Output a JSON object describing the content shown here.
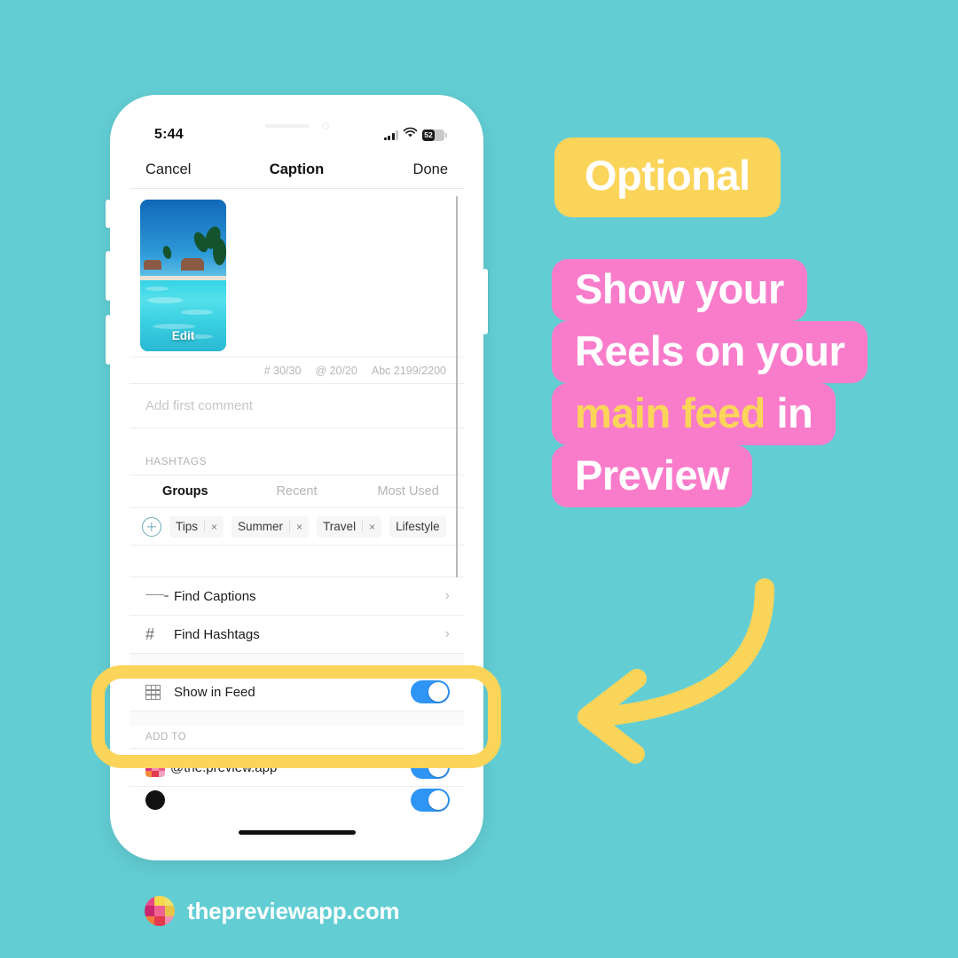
{
  "theme": {
    "background": "#62CED4",
    "yellow": "#FBD45A",
    "pink": "#F97CCB",
    "toggle_blue": "#2F95F5",
    "white": "#FFFFFF"
  },
  "phone": {
    "status_bar": {
      "time": "5:44",
      "signal_icon": "cellular-signal-icon",
      "wifi_icon": "wifi-icon",
      "battery_icon": "battery-icon",
      "battery_percent": "52"
    },
    "nav": {
      "cancel_label": "Cancel",
      "title": "Caption",
      "done_label": "Done"
    },
    "caption": {
      "thumbnail_edit_label": "Edit",
      "counters": [
        "# 30/30",
        "@ 20/20",
        "Abc 2199/2200"
      ],
      "comment_placeholder": "Add first comment"
    },
    "hashtags": {
      "section_label": "HASHTAGS",
      "tabs": [
        {
          "label": "Groups",
          "active": true
        },
        {
          "label": "Recent",
          "active": false
        },
        {
          "label": "Most Used",
          "active": false
        }
      ],
      "add_icon": "plus-circle-icon",
      "chips": [
        {
          "label": "Tips",
          "remove_label": "×"
        },
        {
          "label": "Summer",
          "remove_label": "×"
        },
        {
          "label": "Travel",
          "remove_label": "×"
        },
        {
          "label": "Lifestyle",
          "remove_label": "×"
        }
      ]
    },
    "rows": [
      {
        "label": "Find Captions",
        "icon": "text-lines-icon",
        "accessory": "chevron-right-icon",
        "chevron": "›"
      },
      {
        "label": "Find Hashtags",
        "icon": "hashtag-icon",
        "accessory": "chevron-right-icon",
        "chevron": "›"
      }
    ],
    "show_in_feed": {
      "label": "Show in Feed",
      "icon": "grid-icon",
      "toggle_on": true
    },
    "add_to": {
      "section_label": "ADD TO",
      "accounts": [
        {
          "handle": "@the.preview.app",
          "icon": "preview-app-icon",
          "toggle_on": true
        }
      ]
    },
    "home_indicator": "home-indicator"
  },
  "callouts": {
    "optional_badge": "Optional",
    "pink_lines": [
      {
        "parts": [
          {
            "text": "Show your",
            "accent": false
          }
        ]
      },
      {
        "parts": [
          {
            "text": "Reels on your",
            "accent": false
          }
        ]
      },
      {
        "parts": [
          {
            "text": "main feed",
            "accent": true
          },
          {
            "text": " in",
            "accent": false
          }
        ]
      },
      {
        "parts": [
          {
            "text": "Preview",
            "accent": false
          }
        ]
      }
    ],
    "arrow_icon": "curved-arrow-left-icon",
    "highlight_ring": "highlight-ring"
  },
  "footer": {
    "logo_icon": "preview-app-logo-icon",
    "website": "thepreviewapp.com"
  }
}
